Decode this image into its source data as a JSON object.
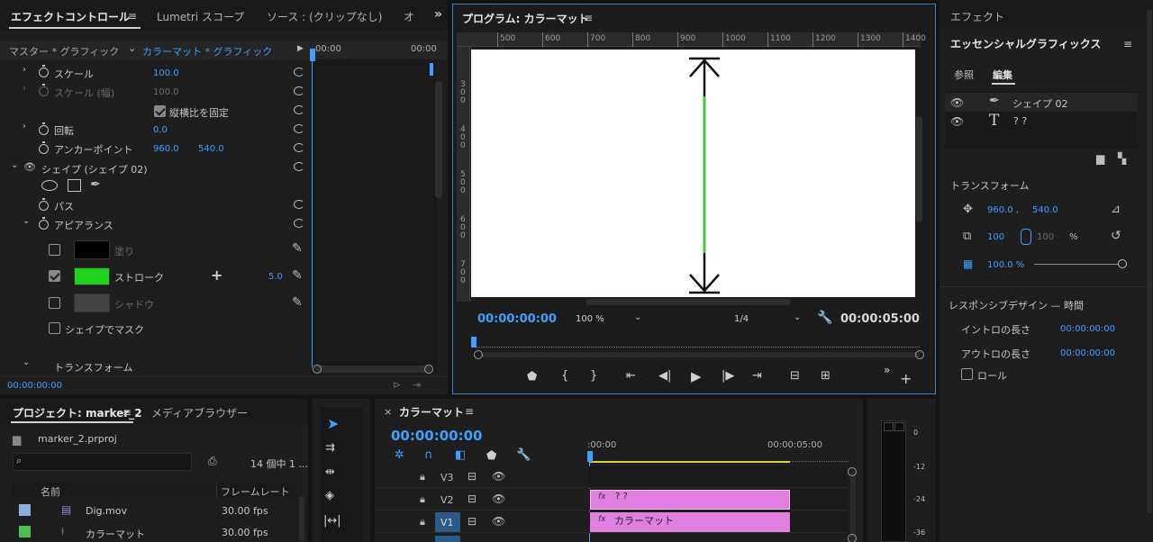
{
  "effect_controls": {
    "tabs": [
      "エフェクトコントロール",
      "Lumetri スコープ",
      "ソース : (クリップなし)",
      "オ"
    ],
    "master_label": "マスター * グラフィック",
    "clip_label": "カラーマット * グラフィック",
    "time_start": "00:00",
    "time_end": "00:00",
    "scale_label": "スケール",
    "scale_value": "100.0",
    "scale_width_label": "スケール (幅)",
    "scale_width_value": "100.0",
    "uniform_label": "縦横比を固定",
    "rotation_label": "回転",
    "rotation_value": "0.0",
    "anchor_label": "アンカーポイント",
    "anchor_x": "960.0",
    "anchor_y": "540.0",
    "shape_label": "シェイプ (シェイプ 02)",
    "path_label": "パス",
    "appearance_label": "アピアランス",
    "fill_label": "塗り",
    "fill_color": "#000000",
    "stroke_label": "ストローク",
    "stroke_color": "#1ed21e",
    "stroke_value": "5.0",
    "shadow_label": "シャドウ",
    "shadow_color": "#444444",
    "mask_label": "シェイプでマスク",
    "transform_label": "トランスフォーム",
    "timecode": "00:00:00:00"
  },
  "program": {
    "title": "プログラム: カラーマット",
    "ruler_top": [
      "500",
      "600",
      "700",
      "800",
      "900",
      "1000",
      "1100",
      "1200",
      "1300",
      "1400"
    ],
    "ruler_left": [
      "3\n0\n0",
      "4\n0\n0",
      "5\n0\n0",
      "6\n0\n0",
      "7\n0\n0"
    ],
    "timecode": "00:00:00:00",
    "zoom": "100 %",
    "resolution": "1/4",
    "duration": "00:00:05:00"
  },
  "essential_graphics": {
    "effect_tab": "エフェクト",
    "title": "エッセンシャルグラフィックス",
    "tab_browse": "参照",
    "tab_edit": "編集",
    "layer1": "シェイプ 02",
    "layer2": "? ?",
    "transform_label": "トランスフォーム",
    "pos_x": "960.0 ,",
    "pos_y": "540.0",
    "scale": "100",
    "scale_w": "100",
    "percent": "%",
    "opacity": "100.0 %",
    "responsive_label": "レスポンシブデザイン — 時間",
    "intro_label": "イントロの長さ",
    "intro_value": "00:00:00:00",
    "outro_label": "アウトロの長さ",
    "outro_value": "00:00:00:00",
    "roll_label": "ロール"
  },
  "project": {
    "tab_project": "プロジェクト: marker_2",
    "tab_media": "メディアブラウザー",
    "file": "marker_2.prproj",
    "count": "14 個中 1 ...",
    "col_name": "名前",
    "col_fps": "フレームレート",
    "items": [
      {
        "name": "Dig.mov",
        "fps": "30.00 fps",
        "color": "#8ab0e0"
      },
      {
        "name": "カラーマット",
        "fps": "30.00 fps",
        "color": "#4fc04f"
      }
    ]
  },
  "timeline": {
    "title": "カラーマット",
    "timecode": "00:00:00:00",
    "time_start": ":00:00",
    "time_end": "00:00:05:00",
    "tracks": [
      "V3",
      "V2",
      "V1"
    ],
    "clip_v2": "? ?",
    "clip_v1": "カラーマット",
    "clip_color": "#e17fe1"
  },
  "meter": {
    "labels": [
      "0",
      "-12",
      "-24",
      "-36"
    ]
  },
  "colors": {
    "accent": "#3ea0ff",
    "highlight_border": "#3b7fc4"
  }
}
